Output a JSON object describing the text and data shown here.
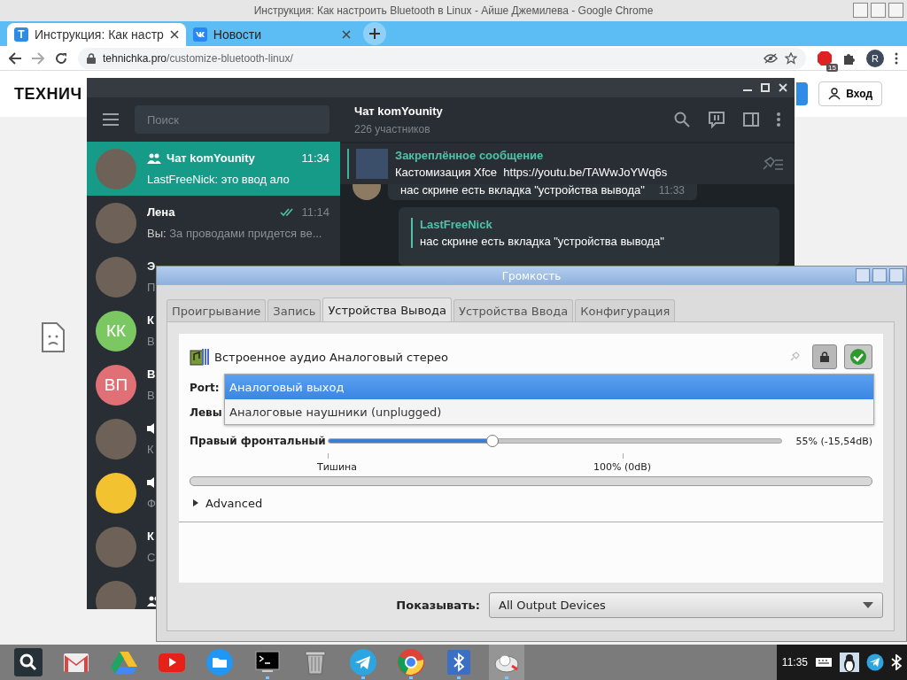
{
  "browser": {
    "title": "Инструкция: Как настроить Bluetooth в Linux - Айше Джемилева - Google Chrome",
    "tabs": [
      {
        "label": "Инструкция: Как настр",
        "selected": true,
        "favicon": {
          "kind": "letter",
          "text": "T"
        }
      },
      {
        "label": "Новости",
        "selected": false,
        "favicon": {
          "kind": "vk"
        }
      }
    ],
    "address": {
      "host": "tehnichka.pro",
      "path": "/customize-bluetooth-linux/"
    },
    "extension_badge": "15",
    "profile_initial": "R",
    "page": {
      "logo": "ТЕХНИЧ",
      "login_button": "Вход"
    }
  },
  "telegram": {
    "search": {
      "placeholder": "Поиск"
    },
    "chats": [
      {
        "name": "Чат komYounity",
        "group": true,
        "channel": false,
        "time": "11:34",
        "read": false,
        "preview": "LastFreeNick: это ввод ало",
        "selected": true,
        "avatar": {
          "kind": "photo"
        }
      },
      {
        "name": "Лена",
        "group": false,
        "channel": false,
        "time": "11:14",
        "read": true,
        "sender": "Вы:",
        "preview": "За проводами придется ве...",
        "selected": false,
        "avatar": {
          "kind": "photo"
        }
      },
      {
        "name": "Э",
        "group": false,
        "channel": false,
        "preview": "П",
        "read": false,
        "selected": false,
        "avatar": {
          "kind": "photo"
        }
      },
      {
        "name": "К",
        "group": false,
        "channel": false,
        "preview": "В",
        "read": false,
        "selected": false,
        "avatar": {
          "kind": "initials",
          "text": "КК",
          "color": "#7bc862"
        }
      },
      {
        "name": "В",
        "group": false,
        "channel": false,
        "preview": "В",
        "read": false,
        "selected": false,
        "avatar": {
          "kind": "initials",
          "text": "ВП",
          "color": "#e17076"
        }
      },
      {
        "group": false,
        "channel": true,
        "preview": "К",
        "read": false,
        "selected": false,
        "avatar": {
          "kind": "photo"
        }
      },
      {
        "group": false,
        "channel": true,
        "preview": "Ф",
        "read": false,
        "selected": false,
        "avatar": {
          "kind": "emoji"
        }
      },
      {
        "name": "К",
        "group": false,
        "channel": false,
        "preview": "С",
        "read": false,
        "selected": false,
        "avatar": {
          "kind": "photo"
        }
      },
      {
        "group": true,
        "channel": false,
        "read": false,
        "selected": false,
        "avatar": {
          "kind": "photo"
        }
      }
    ],
    "header": {
      "title": "Чат komYounity",
      "subtitle": "226 участников"
    },
    "pinned": {
      "title": "Закреплённое сообщение",
      "text": "Кастомизация Xfce  https://youtu.be/TAWwJoYWq6s"
    },
    "messages": [
      {
        "kind": "plain",
        "text": "нас скрине есть вкладка \"устройства вывода\"",
        "time": "11:33"
      },
      {
        "kind": "reply",
        "quote_author": "LastFreeNick",
        "quote_text": "нас скрине есть вкладка \"устройства вывода\""
      }
    ]
  },
  "volume": {
    "title": "Громкость",
    "tabs": [
      {
        "label": "Проигрывание",
        "selected": false
      },
      {
        "label": "Запись",
        "selected": false
      },
      {
        "label": "Устройства Вывода",
        "selected": true
      },
      {
        "label": "Устройства Ввода",
        "selected": false
      },
      {
        "label": "Конфигурация",
        "selected": false
      }
    ],
    "device": "Встроенное аудио Аналоговый стерео",
    "port_label": "Port:",
    "port_options": [
      {
        "label": "Аналоговый выход",
        "selected": true
      },
      {
        "label": "Аналоговые наушники (unplugged)",
        "selected": false
      }
    ],
    "left_label": "Левы",
    "right_channel": {
      "label": "Правый фронтальный",
      "level": 0.363,
      "reading": "55% (-15,54dB)"
    },
    "scale": [
      "Тишина",
      "100% (0dB)"
    ],
    "advanced": {
      "label": "Advanced",
      "expanded": false
    },
    "show_label": "Показывать:",
    "show_value": "All Output Devices"
  },
  "taskbar": {
    "apps": [
      {
        "kind": "search",
        "running": false,
        "active": false
      },
      {
        "kind": "mail",
        "running": false,
        "active": false
      },
      {
        "kind": "drive",
        "running": false,
        "active": false
      },
      {
        "kind": "video",
        "running": false,
        "active": false
      },
      {
        "kind": "files",
        "running": false,
        "active": false
      },
      {
        "kind": "terminal",
        "running": true,
        "active": false
      },
      {
        "kind": "trash",
        "running": false,
        "active": false
      },
      {
        "kind": "telegram",
        "running": true,
        "active": false
      },
      {
        "kind": "browser",
        "running": true,
        "active": false
      },
      {
        "kind": "bluetooth",
        "running": true,
        "active": false
      },
      {
        "kind": "volume",
        "running": true,
        "active": true
      }
    ],
    "time": "11:35"
  }
}
